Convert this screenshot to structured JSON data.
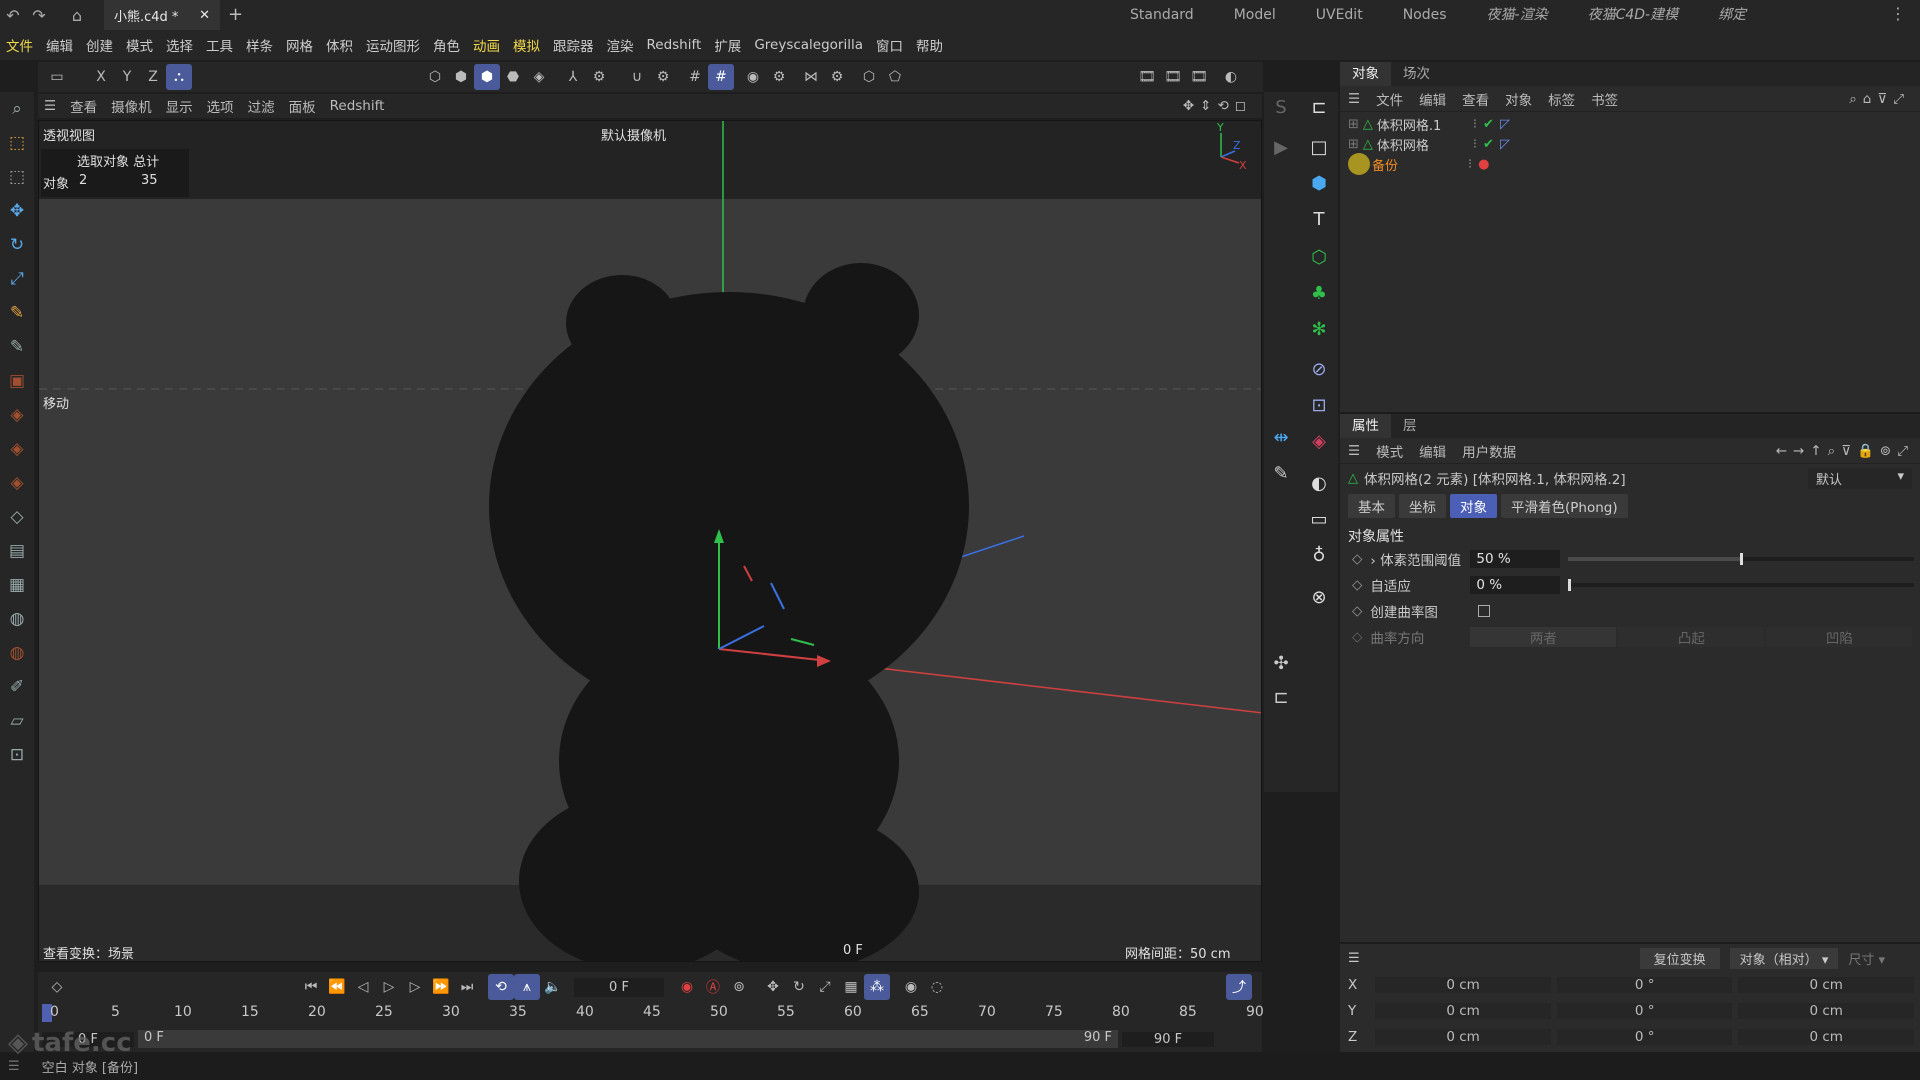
{
  "titlebar": {
    "doc_tab": "小熊.c4d *",
    "layouts": [
      "Standard",
      "Model",
      "UVEdit",
      "Nodes",
      "夜猫-渲染",
      "夜猫C4D-建模",
      "绑定"
    ]
  },
  "menubar": [
    "文件",
    "编辑",
    "创建",
    "模式",
    "选择",
    "工具",
    "样条",
    "网格",
    "体积",
    "运动图形",
    "角色",
    "动画",
    "模拟",
    "跟踪器",
    "渲染",
    "Redshift",
    "扩展",
    "Greyscalegorilla",
    "窗口",
    "帮助"
  ],
  "toolbar": {
    "axes": [
      "X",
      "Y",
      "Z"
    ]
  },
  "viewport": {
    "menu": [
      "查看",
      "摄像机",
      "显示",
      "选项",
      "过滤",
      "面板",
      "Redshift"
    ],
    "name": "透视视图",
    "camera": "默认摄像机",
    "stats_header": "选取对象 总计",
    "stats_label": "对象",
    "stats_selected": "2",
    "stats_total": "35",
    "mode": "移动",
    "view_transform": "查看变换：场景",
    "frame": "0 F",
    "grid_spacing": "网格间距：50 cm"
  },
  "object_manager": {
    "tabs": [
      "对象",
      "场次"
    ],
    "menu": [
      "文件",
      "编辑",
      "查看",
      "对象",
      "标签",
      "书签"
    ],
    "objects": [
      {
        "name": "体积网格.1",
        "color": "#cccccc"
      },
      {
        "name": "体积网格",
        "color": "#cccccc"
      },
      {
        "name": "备份",
        "color": "#f08a24"
      }
    ]
  },
  "attribute_manager": {
    "tabs": [
      "属性",
      "层"
    ],
    "menu": [
      "模式",
      "编辑",
      "用户数据"
    ],
    "selection_title": "体积网格(2 元素) [体积网格.1, 体积网格.2]",
    "preset": "默认",
    "sub_tabs": [
      "基本",
      "坐标",
      "对象",
      "平滑着色(Phong)"
    ],
    "active_sub_tab": "对象",
    "section": "对象属性",
    "props": [
      {
        "label": "体素范围阈值",
        "value": "50 %",
        "slider": 0.5
      },
      {
        "label": "自适应",
        "value": "0 %",
        "slider": 0.0
      }
    ],
    "curvature_map_label": "创建曲率图",
    "curvature_dir_label": "曲率方向",
    "curvature_options": [
      "两者",
      "凸起",
      "凹陷"
    ]
  },
  "coordinates": {
    "reset_button": "复位变换",
    "mode": "对象（相对）",
    "size": "尺寸",
    "rows": [
      {
        "axis": "X",
        "pos": "0 cm",
        "rot": "0 °",
        "size": "0 cm"
      },
      {
        "axis": "Y",
        "pos": "0 cm",
        "rot": "0 °",
        "size": "0 cm"
      },
      {
        "axis": "Z",
        "pos": "0 cm",
        "rot": "0 °",
        "size": "0 cm"
      }
    ]
  },
  "timeline": {
    "current_frame": "0 F",
    "ticks": [
      "0",
      "5",
      "10",
      "15",
      "20",
      "25",
      "30",
      "35",
      "40",
      "45",
      "50",
      "55",
      "60",
      "65",
      "70",
      "75",
      "80",
      "85",
      "90"
    ],
    "range_start": "0 F",
    "range_start2": "0 F",
    "range_end": "90 F",
    "range_end2": "90 F"
  },
  "statusbar": {
    "text": "空白 对象 [备份]",
    "watermark": "tafe.cc"
  },
  "colors": {
    "accent": "#4a5fb5",
    "orange": "#f08a24",
    "green": "#2fbf4a"
  }
}
